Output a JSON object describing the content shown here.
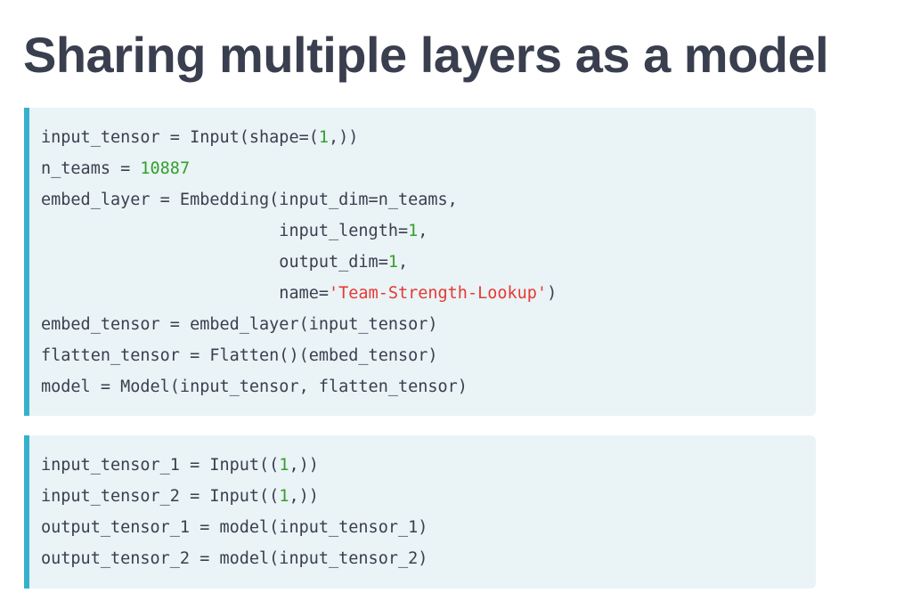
{
  "title": "Sharing multiple layers as a model",
  "colors": {
    "title": "#3a3f4f",
    "code_text": "#3a3f4f",
    "code_background": "#eaf3f5",
    "code_accent_border": "#35b1cc",
    "number_literal": "#33a02c",
    "string_literal": "#e53935"
  },
  "code_blocks": [
    {
      "lines": [
        [
          {
            "t": "input_tensor = Input(shape=(",
            "k": "plain"
          },
          {
            "t": "1",
            "k": "num"
          },
          {
            "t": ",))",
            "k": "plain"
          }
        ],
        [
          {
            "t": "n_teams = ",
            "k": "plain"
          },
          {
            "t": "10887",
            "k": "num"
          }
        ],
        [
          {
            "t": "embed_layer = Embedding(input_dim=n_teams,",
            "k": "plain"
          }
        ],
        [
          {
            "t": "                        input_length=",
            "k": "plain"
          },
          {
            "t": "1",
            "k": "num"
          },
          {
            "t": ",",
            "k": "plain"
          }
        ],
        [
          {
            "t": "                        output_dim=",
            "k": "plain"
          },
          {
            "t": "1",
            "k": "num"
          },
          {
            "t": ",",
            "k": "plain"
          }
        ],
        [
          {
            "t": "                        name=",
            "k": "plain"
          },
          {
            "t": "'Team-Strength-Lookup'",
            "k": "str"
          },
          {
            "t": ")",
            "k": "plain"
          }
        ],
        [
          {
            "t": "embed_tensor = embed_layer(input_tensor)",
            "k": "plain"
          }
        ],
        [
          {
            "t": "flatten_tensor = Flatten()(embed_tensor)",
            "k": "plain"
          }
        ],
        [
          {
            "t": "model = Model(input_tensor, flatten_tensor)",
            "k": "plain"
          }
        ]
      ]
    },
    {
      "lines": [
        [
          {
            "t": "input_tensor_1 = Input((",
            "k": "plain"
          },
          {
            "t": "1",
            "k": "num"
          },
          {
            "t": ",))",
            "k": "plain"
          }
        ],
        [
          {
            "t": "input_tensor_2 = Input((",
            "k": "plain"
          },
          {
            "t": "1",
            "k": "num"
          },
          {
            "t": ",))",
            "k": "plain"
          }
        ],
        [
          {
            "t": "output_tensor_1 = model(input_tensor_1)",
            "k": "plain"
          }
        ],
        [
          {
            "t": "output_tensor_2 = model(input_tensor_2)",
            "k": "plain"
          }
        ]
      ]
    }
  ]
}
